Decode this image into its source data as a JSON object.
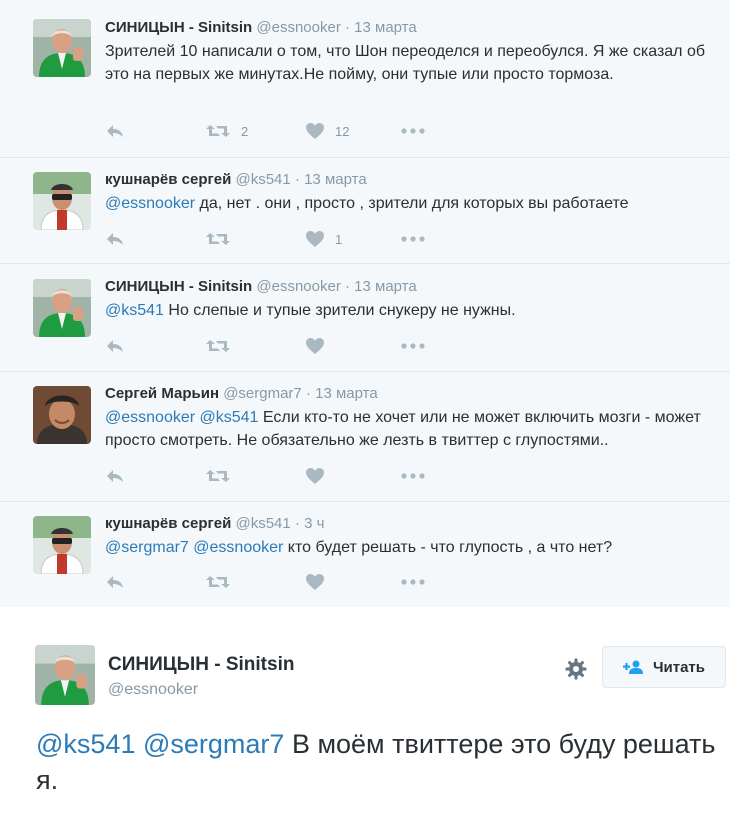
{
  "tweets": [
    {
      "name": "СИНИЦЫН - Sinitsin",
      "handle": "@essnooker",
      "sep": "·",
      "time": "13 марта",
      "text": "Зрителей 10 написали о том, что Шон переоделся и переобулся. Я же сказал об это на первых же минутах.Не пойму, они тупые или просто тормоза.",
      "retweets": "2",
      "likes": "12"
    },
    {
      "name": "кушнарёв сергей",
      "handle": "@ks541",
      "sep": "·",
      "time": "13 марта",
      "mention1": "@essnooker",
      "text": " да, нет . они , просто , зрители для которых вы работаете",
      "retweets": "",
      "likes": "1"
    },
    {
      "name": "СИНИЦЫН - Sinitsin",
      "handle": "@essnooker",
      "sep": "·",
      "time": "13 марта",
      "mention1": "@ks541",
      "text": " Но слепые и тупые зрители снукеру не нужны.",
      "retweets": "",
      "likes": ""
    },
    {
      "name": "Сергей Марьин",
      "handle": "@sergmar7",
      "sep": "·",
      "time": "13 марта",
      "mention1": "@essnooker",
      "mention2": "@ks541",
      "text": " Если кто-то не хочет или не может включить мозги - может просто смотреть. Не обязательно же лезть в твиттер с глупостями..",
      "retweets": "",
      "likes": ""
    },
    {
      "name": "кушнарёв сергей",
      "handle": "@ks541",
      "sep": "·",
      "time": "3 ч",
      "mention1": "@sergmar7",
      "mention2": "@essnooker",
      "text": " кто будет решать - что глупость , а что нет?",
      "retweets": "",
      "likes": ""
    }
  ],
  "main": {
    "name": "СИНИЦЫН - Sinitsin",
    "handle": "@essnooker",
    "follow_label": "Читать",
    "mention1": "@ks541",
    "mention2": "@sergmar7",
    "text": " В моём твиттере это буду решать я."
  },
  "colors": {
    "link": "#2b7bb9",
    "muted": "#8899a6",
    "icon": "#aab8c2",
    "thread_bg": "#f5f8fa"
  },
  "icons": {
    "reply": "reply-icon",
    "retweet": "retweet-icon",
    "like": "heart-icon",
    "more": "more-dots-icon",
    "settings": "gear-icon",
    "follow": "follow-user-icon"
  }
}
